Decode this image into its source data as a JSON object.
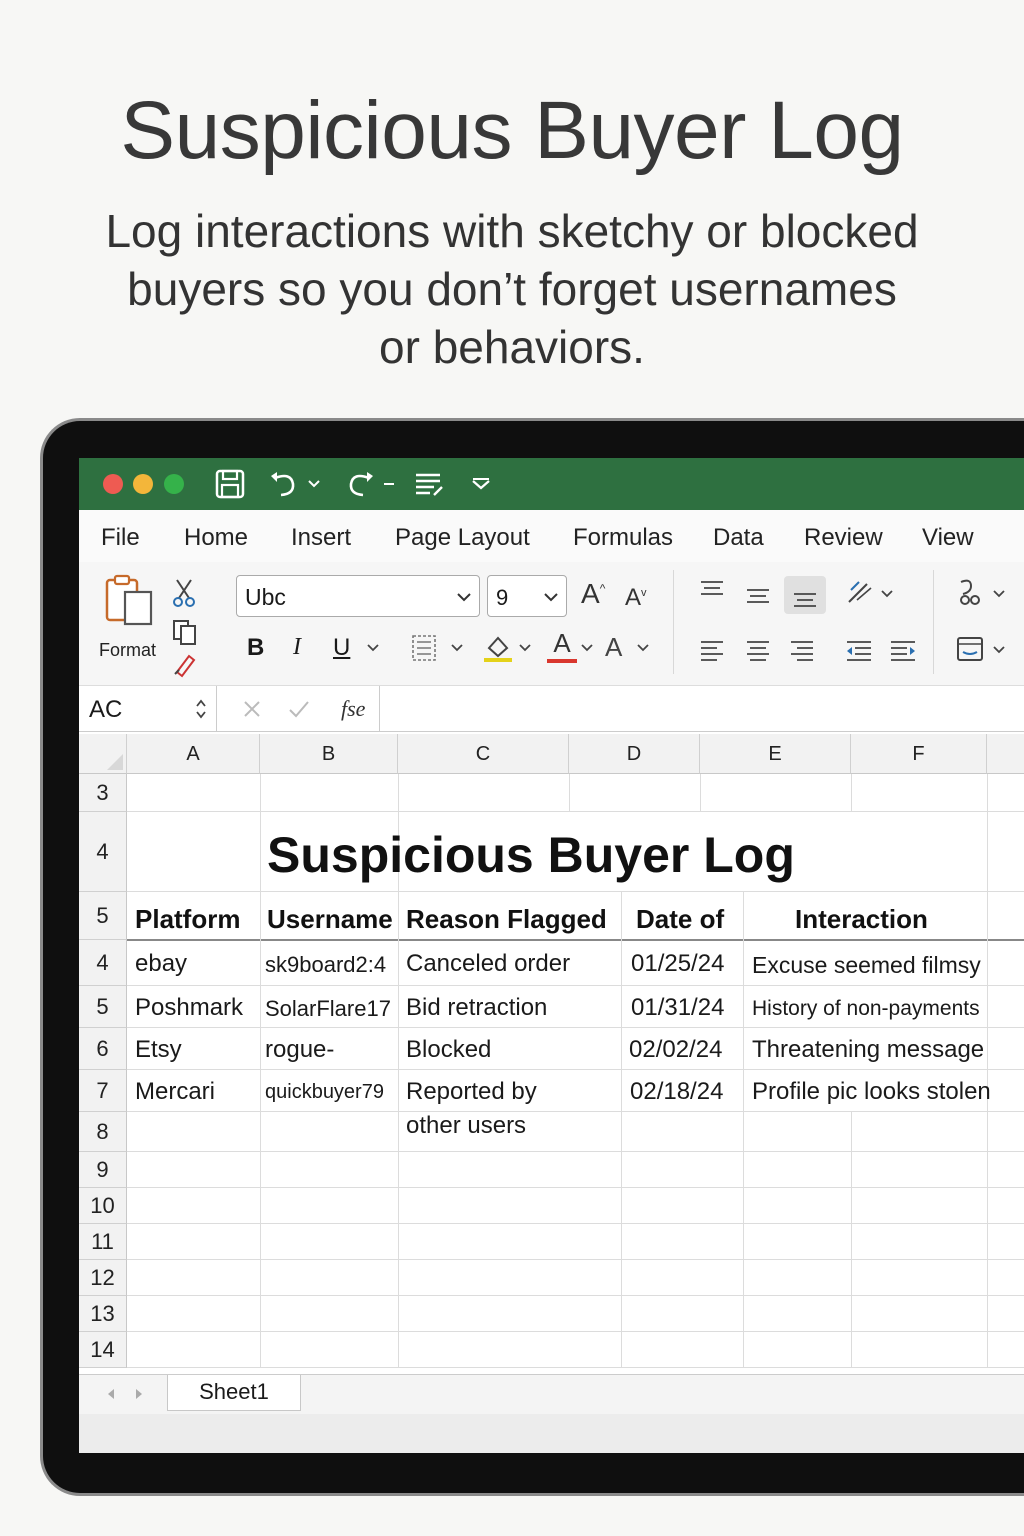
{
  "hero": {
    "title": "Suspicious Buyer Log",
    "subtitle_lines": [
      "Log interactions with sketchy or blocked",
      "buyers so you don’t forget usernames",
      "or behaviors."
    ]
  },
  "colors": {
    "title_bar": "#2e7040",
    "close": "#ee5b52",
    "minimize": "#f3b63a",
    "zoom": "#35b24a"
  },
  "menu": [
    "File",
    "Home",
    "Insert",
    "Page Layout",
    "Formulas",
    "Data",
    "Review",
    "View"
  ],
  "ribbon": {
    "format_label": "Format",
    "font_name": "Ubc",
    "font_size": "9",
    "bold": "B",
    "italic": "I",
    "underline": "U",
    "grow_font": "A",
    "shrink_font": "A",
    "font_color": "A",
    "text_effects": "A"
  },
  "formula_bar": {
    "name_box": "AC",
    "fx": "fse",
    "value": ""
  },
  "columns": [
    "A",
    "B",
    "C",
    "D",
    "E",
    "F"
  ],
  "rows": {
    "top_row": "3",
    "title_row": "4",
    "header_row": "5",
    "data_rows": [
      "4",
      "5",
      "6",
      "7"
    ],
    "empty_rows": [
      "8",
      "9",
      "10",
      "11",
      "12",
      "13",
      "14"
    ]
  },
  "sheet_title": "Suspicious Buyer Log",
  "table": {
    "headers": [
      "Platform",
      "Username",
      "Reason Flagged",
      "Date of",
      "Interaction"
    ],
    "rows": [
      {
        "platform": "ebay",
        "username": "sk9board2:4",
        "reason": "Canceled order",
        "date": "01/25/24",
        "interaction": "Excuse seemed filmsy"
      },
      {
        "platform": "Poshmark",
        "username": "SolarFlare17",
        "reason": "Bid retraction",
        "date": "01/31/24",
        "interaction": "History of non-payments"
      },
      {
        "platform": "Etsy",
        "username": "rogue-",
        "reason": "Blocked",
        "date": "02/02/24",
        "interaction": "Threatening message"
      },
      {
        "platform": "Mercari",
        "username": "quickbuyer79",
        "reason": "Reported by",
        "reason_line2": "other users",
        "date": "02/18/24",
        "interaction": "Profile pic looks stolen"
      }
    ]
  },
  "sheet_tabs": [
    "Sheet1"
  ]
}
